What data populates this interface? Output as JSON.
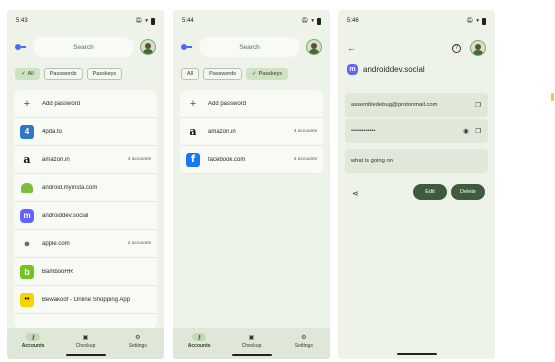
{
  "screens": [
    {
      "time": "5:43",
      "search_placeholder": "Search",
      "chips": [
        {
          "label": "All",
          "selected": true
        },
        {
          "label": "Passwords",
          "selected": false
        },
        {
          "label": "Passkeys",
          "selected": false
        }
      ],
      "add_label": "Add password",
      "items": [
        {
          "name": "4pda.to",
          "meta": "",
          "icon": "4pda-icon",
          "glyph": "4"
        },
        {
          "name": "amazon.in",
          "meta": "4 accounts",
          "icon": "amazon-icon",
          "glyph": "a"
        },
        {
          "name": "android.myinsta.com",
          "meta": "",
          "icon": "android-icon",
          "glyph": ""
        },
        {
          "name": "androiddev.social",
          "meta": "",
          "icon": "mastodon-icon",
          "glyph": "m"
        },
        {
          "name": "apple.com",
          "meta": "2 accounts",
          "icon": "apple-icon",
          "glyph": ""
        },
        {
          "name": "BambooHR",
          "meta": "",
          "icon": "bamboohr-icon",
          "glyph": "b"
        },
        {
          "name": "Bewakoof - Online Shopping App",
          "meta": "",
          "icon": "bewakoof-icon",
          "glyph": "••"
        }
      ],
      "nav": [
        {
          "label": "Accounts",
          "icon": "key-icon",
          "glyph": "⚷",
          "selected": true
        },
        {
          "label": "Checkup",
          "icon": "checkup-icon",
          "glyph": "▣",
          "selected": false
        },
        {
          "label": "Settings",
          "icon": "gear-icon",
          "glyph": "⚙",
          "selected": false
        }
      ]
    },
    {
      "time": "5:44",
      "search_placeholder": "Search",
      "chips": [
        {
          "label": "All",
          "selected": false
        },
        {
          "label": "Passwords",
          "selected": false
        },
        {
          "label": "Passkeys",
          "selected": true
        }
      ],
      "add_label": "Add password",
      "items": [
        {
          "name": "amazon.in",
          "meta": "4 accounts",
          "icon": "amazon-icon",
          "glyph": "a"
        },
        {
          "name": "facebook.com",
          "meta": "3 accounts",
          "icon": "facebook-icon",
          "glyph": "f"
        }
      ],
      "nav": [
        {
          "label": "Accounts",
          "icon": "key-icon",
          "glyph": "⚷",
          "selected": true
        },
        {
          "label": "Checkup",
          "icon": "checkup-icon",
          "glyph": "▣",
          "selected": false
        },
        {
          "label": "Settings",
          "icon": "gear-icon",
          "glyph": "⚙",
          "selected": false
        }
      ]
    }
  ],
  "detail": {
    "time": "5:46",
    "title": "androiddev.social",
    "username": "assembledebug@protonmail.com",
    "password_masked": "••••••••••••",
    "note": "what is going on",
    "edit_label": "Edit",
    "delete_label": "Delete"
  },
  "colors": {
    "screen_bg": "#eef3ea",
    "accent": "#3e5c3a",
    "chip_selected": "#cfe3c2"
  }
}
